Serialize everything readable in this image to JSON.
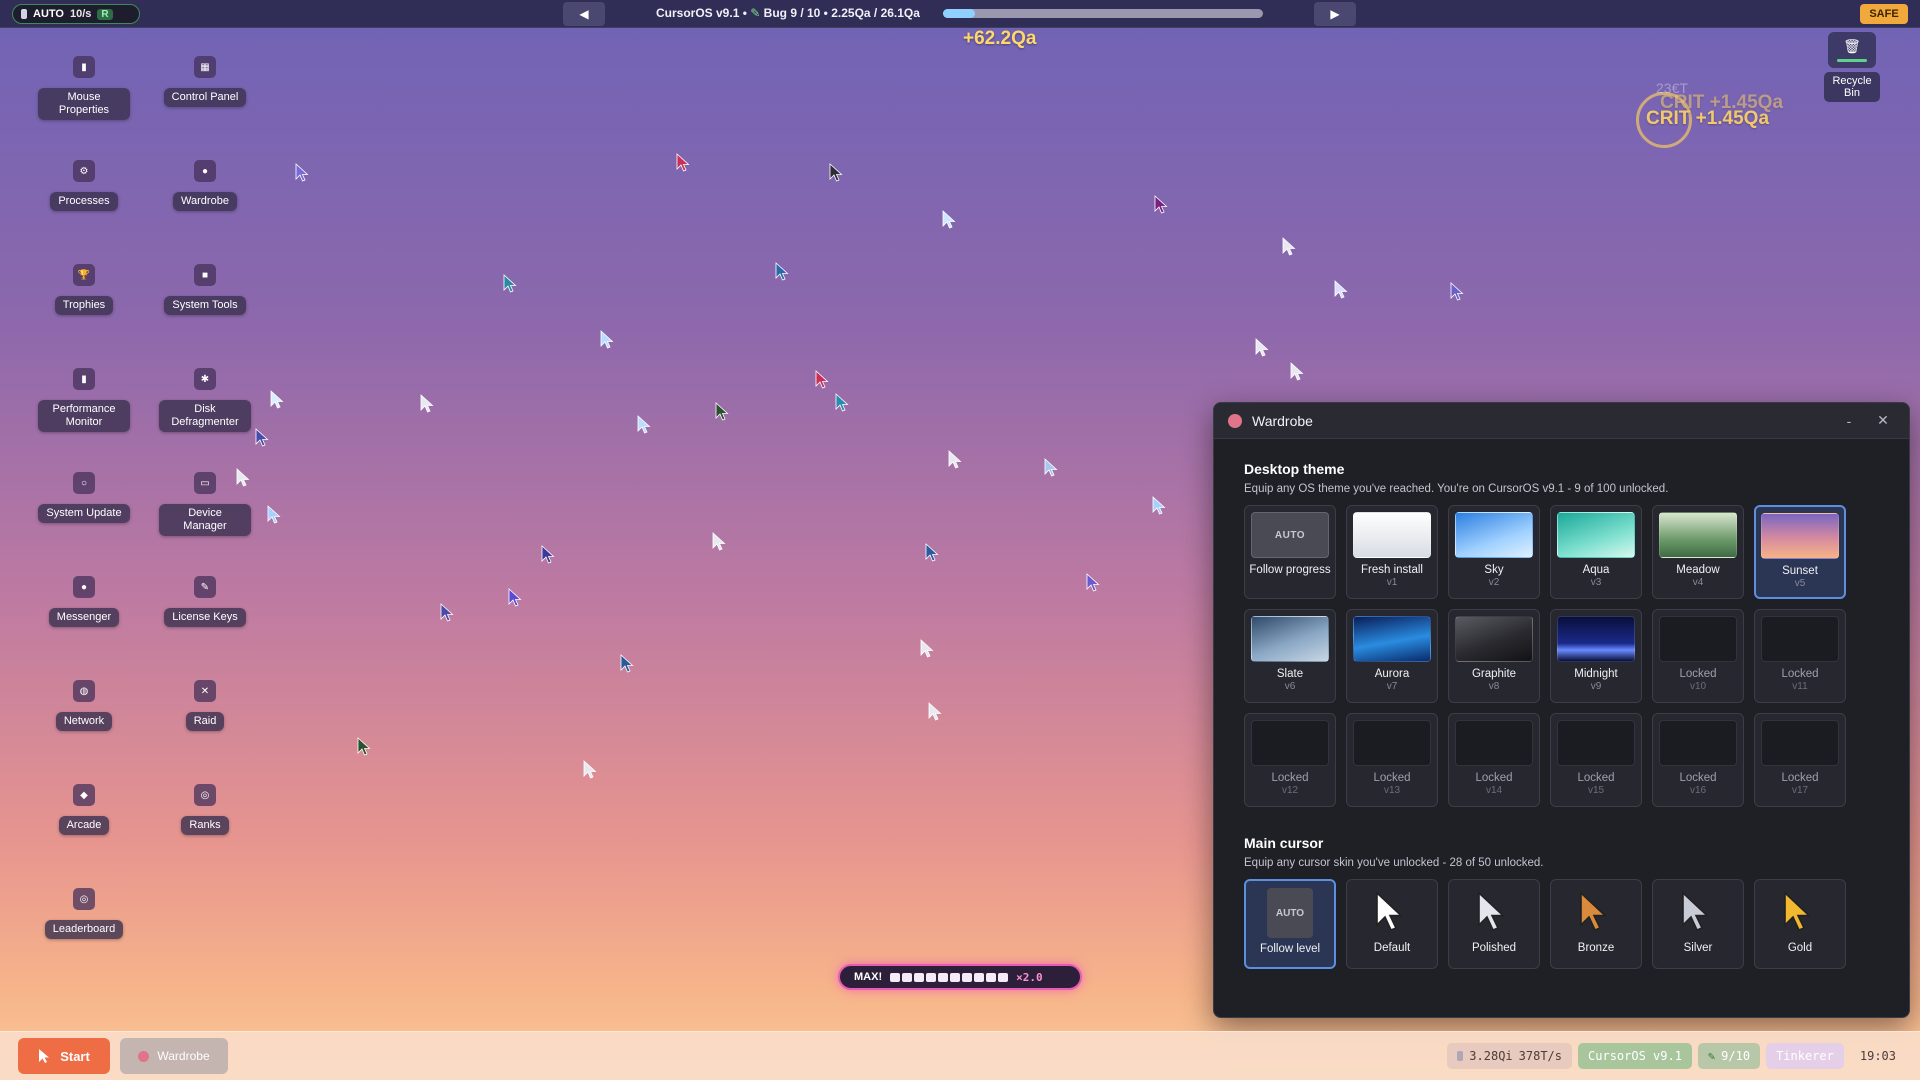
{
  "topbar": {
    "auto_label": "AUTO",
    "rate": "10/s",
    "r_badge": "R",
    "prev_icon": "◀",
    "next_icon": "▶",
    "os_name": "CursorOS v9.1 •",
    "bug_text": "Bug 9 / 10 • 2.25Qa / 26.1Qa",
    "progress_fraction": 0.1,
    "safe_label": "SAFE"
  },
  "floating": {
    "gain": "+62.2Qa",
    "crit_a": "CRIT +1.45Qa",
    "crit_b": "CRIT +1.45Qa",
    "ghost": "23€T"
  },
  "desktop_icons": {
    "mouse_properties": {
      "label": "Mouse Properties",
      "glyph": "▮"
    },
    "control_panel": {
      "label": "Control Panel",
      "glyph": "▦"
    },
    "processes": {
      "label": "Processes",
      "glyph": "⚙"
    },
    "wardrobe": {
      "label": "Wardrobe",
      "glyph": "●"
    },
    "trophies": {
      "label": "Trophies",
      "glyph": "🏆"
    },
    "system_tools": {
      "label": "System Tools",
      "glyph": "■"
    },
    "performance_monitor": {
      "label": "Performance Monitor",
      "glyph": "▮"
    },
    "disk_defragmenter": {
      "label": "Disk Defragmenter",
      "glyph": "✱"
    },
    "system_update": {
      "label": "System Update",
      "glyph": "○"
    },
    "device_manager": {
      "label": "Device Manager",
      "glyph": "▭"
    },
    "messenger": {
      "label": "Messenger",
      "glyph": "●"
    },
    "license_keys": {
      "label": "License Keys",
      "glyph": "✎"
    },
    "network": {
      "label": "Network",
      "glyph": "◍"
    },
    "raid": {
      "label": "Raid",
      "glyph": "✕"
    },
    "arcade": {
      "label": "Arcade",
      "glyph": "◆"
    },
    "ranks": {
      "label": "Ranks",
      "glyph": "◎"
    },
    "leaderboard": {
      "label": "Leaderboard",
      "glyph": "◎"
    }
  },
  "recycle_bin": {
    "label": "Recycle Bin",
    "glyph": "🗑"
  },
  "combo": {
    "label": "MAX!",
    "multiplier": "×2.0",
    "segments": 10
  },
  "wardrobe_window": {
    "title": "Wardrobe",
    "minimize": "-",
    "close": "✕",
    "theme_section": {
      "heading": "Desktop theme",
      "subtitle": "Equip any OS theme you've reached. You're on CursorOS v9.1 - 9 of 100 unlocked.",
      "tiles": [
        {
          "name": "Follow progress",
          "ver": "",
          "swatch": "AUTO",
          "selected": false,
          "locked": false,
          "color": "auto"
        },
        {
          "name": "Fresh install",
          "ver": "v1",
          "swatch": "",
          "selected": false,
          "locked": false,
          "color": "linear-gradient(180deg,#ffffff,#d8dce4)"
        },
        {
          "name": "Sky",
          "ver": "v2",
          "swatch": "",
          "selected": false,
          "locked": false,
          "color": "linear-gradient(160deg,#2d7fe0,#9fd0ff 60%,#dff0ff)"
        },
        {
          "name": "Aqua",
          "ver": "v3",
          "swatch": "",
          "selected": false,
          "locked": false,
          "color": "linear-gradient(160deg,#1aa89a,#7fe0cf 60%,#d8f7ef)"
        },
        {
          "name": "Meadow",
          "ver": "v4",
          "swatch": "",
          "selected": false,
          "locked": false,
          "color": "linear-gradient(180deg,#d8e6d0,#6d9a6a 60%,#3e6b44)"
        },
        {
          "name": "Sunset",
          "ver": "v5",
          "selected": true,
          "locked": false,
          "swatch": "",
          "color": "linear-gradient(180deg,#7a66c2,#d68aa0 55%,#f6b487)"
        },
        {
          "name": "Slate",
          "ver": "v6",
          "swatch": "",
          "selected": false,
          "locked": false,
          "color": "linear-gradient(160deg,#2f4a6a,#8aa7c4 55%,#c8d6e4)"
        },
        {
          "name": "Aurora",
          "ver": "v7",
          "swatch": "",
          "selected": false,
          "locked": false,
          "color": "linear-gradient(170deg,#0a1e5a,#2a8ce0 55%,#0a2a6a)"
        },
        {
          "name": "Graphite",
          "ver": "v8",
          "swatch": "",
          "selected": false,
          "locked": false,
          "color": "linear-gradient(160deg,#5a5a62,#2a2a30 55%,#121216)"
        },
        {
          "name": "Midnight",
          "ver": "v9",
          "swatch": "",
          "selected": false,
          "locked": false,
          "color": "linear-gradient(180deg,#0a0f3a,#1a2a8a 60%,#6a8aff 75%,#0a0f3a)"
        },
        {
          "name": "Locked",
          "ver": "v10",
          "swatch": "",
          "selected": false,
          "locked": true,
          "color": ""
        },
        {
          "name": "Locked",
          "ver": "v11",
          "swatch": "",
          "selected": false,
          "locked": true,
          "color": ""
        },
        {
          "name": "Locked",
          "ver": "v12",
          "swatch": "",
          "selected": false,
          "locked": true,
          "color": ""
        },
        {
          "name": "Locked",
          "ver": "v13",
          "swatch": "",
          "selected": false,
          "locked": true,
          "color": ""
        },
        {
          "name": "Locked",
          "ver": "v14",
          "swatch": "",
          "selected": false,
          "locked": true,
          "color": ""
        },
        {
          "name": "Locked",
          "ver": "v15",
          "swatch": "",
          "selected": false,
          "locked": true,
          "color": ""
        },
        {
          "name": "Locked",
          "ver": "v16",
          "swatch": "",
          "selected": false,
          "locked": true,
          "color": ""
        },
        {
          "name": "Locked",
          "ver": "v17",
          "swatch": "",
          "selected": false,
          "locked": true,
          "color": ""
        }
      ]
    },
    "cursor_section": {
      "heading": "Main cursor",
      "subtitle": "Equip any cursor skin you've unlocked - 28 of 50 unlocked.",
      "tiles": [
        {
          "name": "Follow level",
          "art": "AUTO",
          "selected": true,
          "color": ""
        },
        {
          "name": "Default",
          "art": "",
          "selected": false,
          "color": "#ffffff"
        },
        {
          "name": "Polished",
          "art": "",
          "selected": false,
          "color": "#e4e6ee"
        },
        {
          "name": "Bronze",
          "art": "",
          "selected": false,
          "color": "#d98a3c"
        },
        {
          "name": "Silver",
          "art": "",
          "selected": false,
          "color": "#c8ccd6"
        },
        {
          "name": "Gold",
          "art": "",
          "selected": false,
          "color": "#f2b830"
        }
      ]
    }
  },
  "taskbar": {
    "start_label": "Start",
    "task_label": "Wardrobe",
    "tray": {
      "points": "3.28Qi",
      "rate": "378T/s",
      "os": "CursorOS v9.1",
      "bugs": "9/10",
      "rank": "Tinkerer",
      "clock": "19:03"
    }
  },
  "colors": {
    "accent": "#ef6d45",
    "select_border": "#5d8fe0",
    "safe": "#f2a93b",
    "gain": "#ffd86b"
  }
}
